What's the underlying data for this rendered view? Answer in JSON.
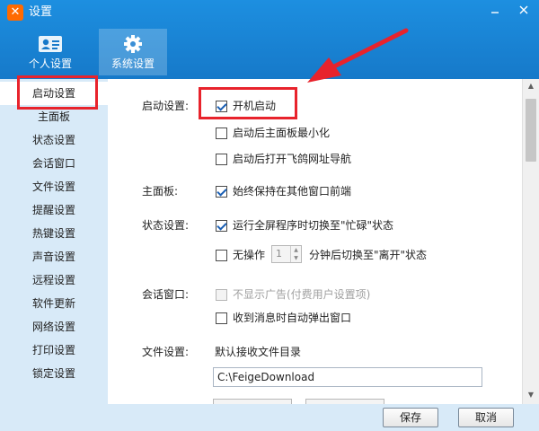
{
  "window": {
    "title": "设置",
    "app_icon": "feige-logo-icon",
    "controls": {
      "close": "✕"
    }
  },
  "top_tabs": [
    {
      "label": "个人设置",
      "icon": "person-card-icon",
      "active": false
    },
    {
      "label": "系统设置",
      "icon": "gear-icon",
      "active": true
    }
  ],
  "sidebar": {
    "items": [
      {
        "label": "启动设置",
        "active": true
      },
      {
        "label": "主面板",
        "active": false
      },
      {
        "label": "状态设置",
        "active": false
      },
      {
        "label": "会话窗口",
        "active": false
      },
      {
        "label": "文件设置",
        "active": false
      },
      {
        "label": "提醒设置",
        "active": false
      },
      {
        "label": "热键设置",
        "active": false
      },
      {
        "label": "声音设置",
        "active": false
      },
      {
        "label": "远程设置",
        "active": false
      },
      {
        "label": "软件更新",
        "active": false
      },
      {
        "label": "网络设置",
        "active": false
      },
      {
        "label": "打印设置",
        "active": false
      },
      {
        "label": "锁定设置",
        "active": false
      }
    ]
  },
  "sections": {
    "startup": {
      "label": "启动设置:",
      "options": [
        {
          "text": "开机启动",
          "checked": true
        },
        {
          "text": "启动后主面板最小化",
          "checked": false
        },
        {
          "text": "启动后打开飞鸽网址导航",
          "checked": false
        }
      ]
    },
    "main_panel": {
      "label": "主面板:",
      "options": [
        {
          "text": "始终保持在其他窗口前端",
          "checked": true
        }
      ]
    },
    "status": {
      "label": "状态设置:",
      "fullscreen_option": {
        "text": "运行全屏程序时切换至\"忙碌\"状态",
        "checked": true
      },
      "idle_option": {
        "prefix": "无操作",
        "minutes": "1",
        "suffix": "分钟后切换至\"离开\"状态",
        "checked": false
      }
    },
    "chat": {
      "label": "会话窗口:",
      "options": [
        {
          "text": "不显示广告(付费用户设置项)",
          "checked": false,
          "disabled": true
        },
        {
          "text": "收到消息时自动弹出窗口",
          "checked": false
        }
      ]
    },
    "file": {
      "label": "文件设置:",
      "dir_label": "默认接收文件目录",
      "dir_value": "C:\\FeigeDownload"
    }
  },
  "footer": {
    "save": "保存",
    "cancel": "取消"
  },
  "colors": {
    "header_blue": "#1679c9",
    "sidebar_bg": "#d8eaf8",
    "annotation_red": "#e8232c"
  }
}
